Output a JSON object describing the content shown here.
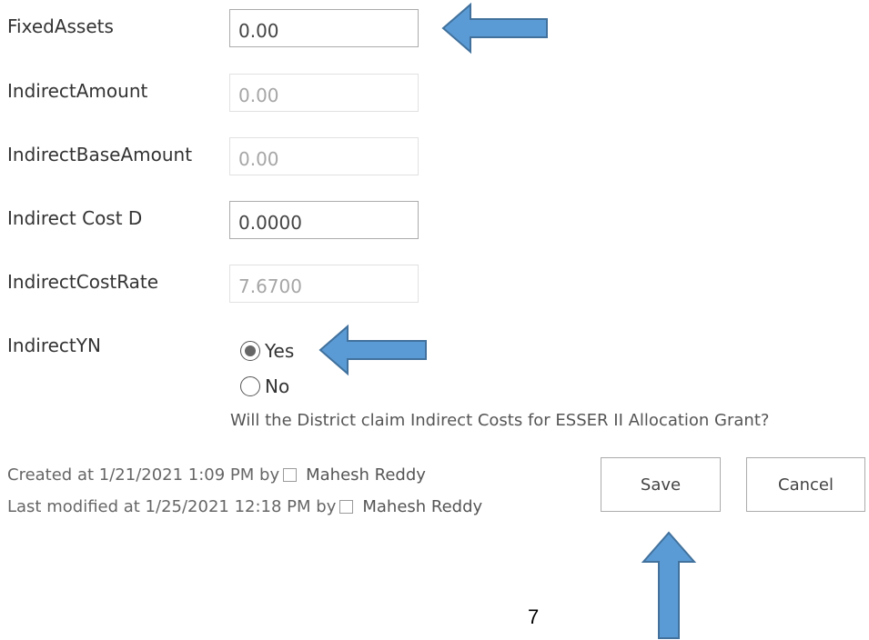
{
  "form": {
    "fields": [
      {
        "label": "FixedAssets",
        "value": "0.00"
      },
      {
        "label": "IndirectAmount",
        "value": "0.00"
      },
      {
        "label": "IndirectBaseAmount",
        "value": "0.00"
      },
      {
        "label": "Indirect Cost D",
        "value": "0.0000"
      },
      {
        "label": "IndirectCostRate",
        "value": "7.6700"
      }
    ],
    "indirect_yn": {
      "label": "IndirectYN",
      "options": [
        "Yes",
        "No"
      ],
      "selected": "Yes",
      "hint": "Will the District claim Indirect Costs for ESSER II Allocation Grant?"
    }
  },
  "footer": {
    "created_prefix": "Created at 1/21/2021 1:09 PM  by",
    "created_by": "Mahesh Reddy",
    "modified_prefix": "Last modified at 1/25/2021 12:18 PM  by",
    "modified_by": "Mahesh Reddy",
    "save_label": "Save",
    "cancel_label": "Cancel"
  },
  "page_number": "7",
  "colors": {
    "annotation_arrow_fill": "#5b9bd5",
    "annotation_arrow_stroke": "#41719c"
  }
}
